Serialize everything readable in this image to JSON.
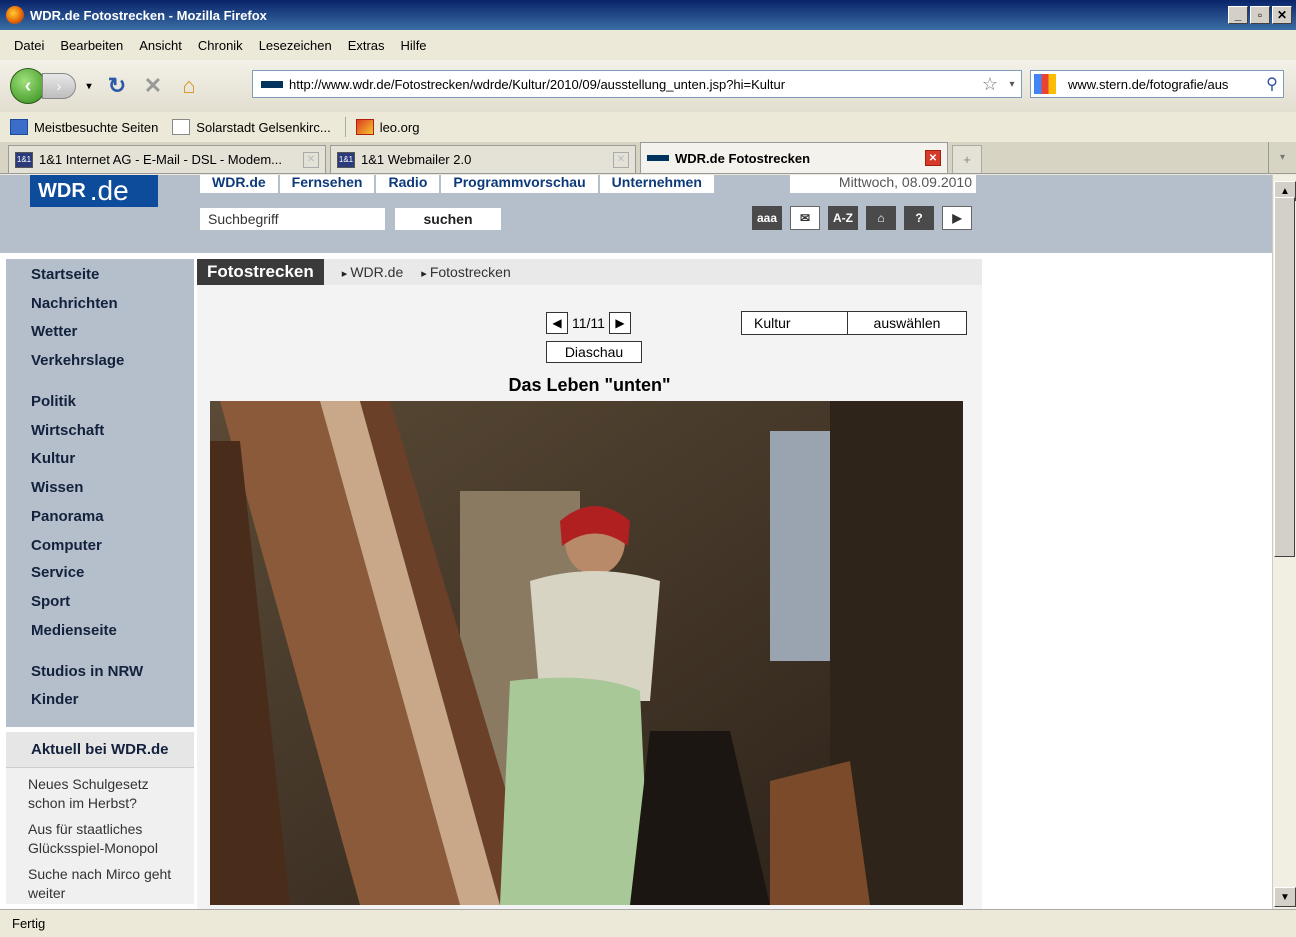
{
  "window": {
    "title": "WDR.de Fotostrecken - Mozilla Firefox"
  },
  "menu": [
    "Datei",
    "Bearbeiten",
    "Ansicht",
    "Chronik",
    "Lesezeichen",
    "Extras",
    "Hilfe"
  ],
  "nav": {
    "url": "http://www.wdr.de/Fotostrecken/wdrde/Kultur/2010/09/ausstellung_unten.jsp?hi=Kultur",
    "search_value": "www.stern.de/fotografie/aus"
  },
  "bookmarks": [
    "Meistbesuchte Seiten",
    "Solarstadt Gelsenkirc...",
    "leo.org"
  ],
  "tabs": [
    {
      "label": "1&1 Internet AG - E-Mail - DSL - Modem...",
      "icon": "1&1"
    },
    {
      "label": "1&1 Webmailer 2.0",
      "icon": "1&1"
    },
    {
      "label": "WDR.de Fotostrecken",
      "active": true
    }
  ],
  "site": {
    "logo": "WDR",
    "logo_suffix": ".de",
    "topnav": [
      "WDR.de",
      "Fernsehen",
      "Radio",
      "Programmvorschau",
      "Unternehmen"
    ],
    "date": "Mittwoch, 08.09.2010",
    "search_placeholder": "Suchbegriff",
    "search_button": "suchen",
    "tools": [
      "aaa",
      "✉",
      "A-Z",
      "⌂",
      "?",
      "▶"
    ]
  },
  "leftnav": {
    "items": [
      "Startseite",
      "Nachrichten",
      "Wetter",
      "Verkehrslage",
      "Politik",
      "Wirtschaft",
      "Kultur",
      "Wissen",
      "Panorama",
      "Computer",
      "Service",
      "Sport",
      "Medienseite",
      "Studios in NRW",
      "Kinder"
    ],
    "aktuell_title": "Aktuell bei WDR.de",
    "aktuell_links": [
      "Neues Schulgesetz schon im Herbst?",
      "Aus für staatliches Glücksspiel-Monopol",
      "Suche nach Mirco geht weiter"
    ]
  },
  "main": {
    "section": "Fotostrecken",
    "breadcrumbs": [
      "WDR.de",
      "Fotostrecken"
    ],
    "counter": "11/11",
    "slideshow": "Diaschau",
    "category_value": "Kultur",
    "category_button": "auswählen",
    "photo_title": "Das Leben \"unten\""
  },
  "status": "Fertig"
}
